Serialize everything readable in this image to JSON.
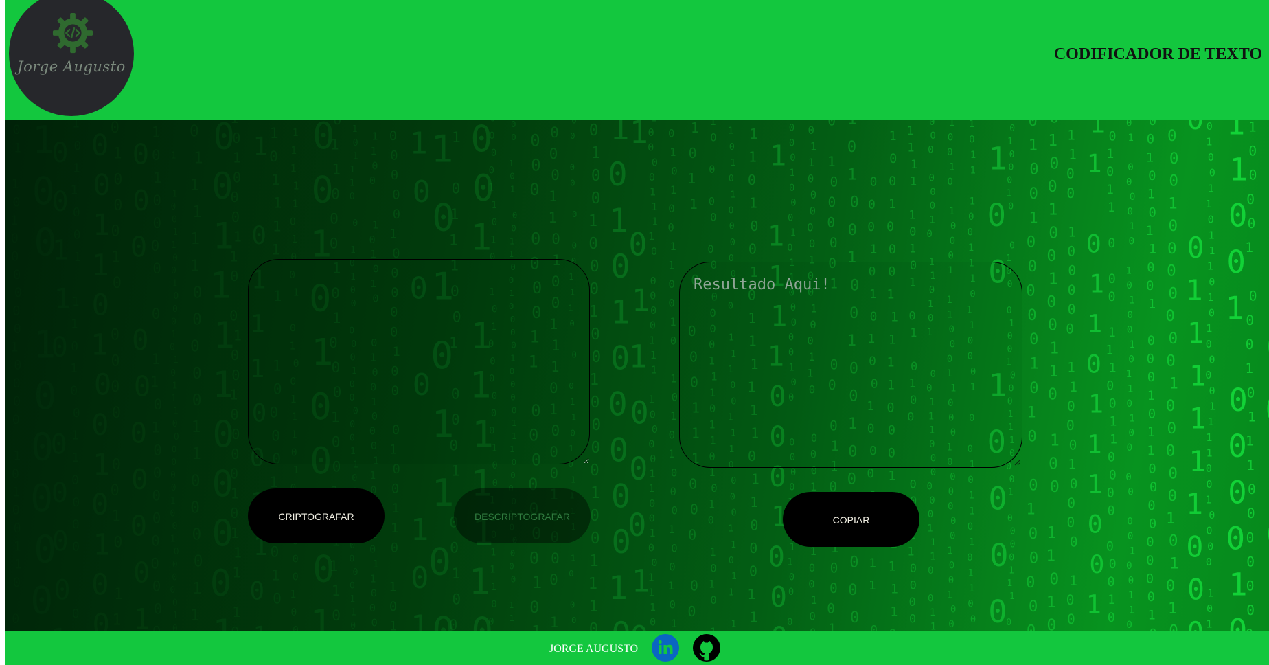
{
  "header": {
    "logo_text": "Jorge Augusto",
    "title": "CODIFICADOR DE TEXTO"
  },
  "main": {
    "input_value": "",
    "output_placeholder": "Resultado Aqui!",
    "buttons": {
      "encrypt": "CRIPTOGRAFAR",
      "decrypt": "DESCRIPTOGRAFAR",
      "copy": "COPIAR"
    }
  },
  "footer": {
    "name": "JORGE AUGUSTO",
    "links": [
      {
        "icon": "linkedin-icon"
      },
      {
        "icon": "github-icon"
      }
    ]
  },
  "colors": {
    "header_bg": "#13c73e",
    "footer_bg": "#13c73e",
    "logo_bg": "#26272b",
    "button_bg": "#000000",
    "linkedin_blue": "#0a66c2"
  }
}
